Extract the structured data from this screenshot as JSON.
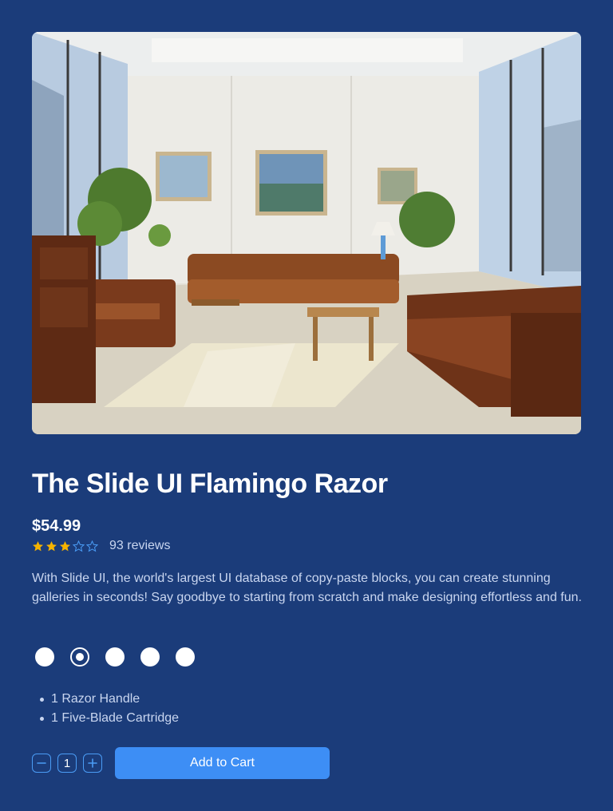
{
  "product": {
    "image_alt": "Sunlit office lounge with brown leather sofas",
    "title": "The Slide UI Flamingo Razor",
    "price": "$54.99",
    "rating": {
      "value": 3,
      "max": 5,
      "reviews_label": "93 reviews"
    },
    "description": "With Slide UI, the world's largest UI database of copy-paste blocks, you can create stunning galleries in seconds! Say goodbye to starting from scratch and make designing effortless and fun.",
    "swatches": {
      "count": 5,
      "selected_index": 1
    },
    "features": [
      "1 Razor Handle",
      "1 Five-Blade Cartridge"
    ],
    "quantity": "1",
    "add_to_cart_label": "Add to Cart"
  },
  "colors": {
    "background": "#1b3c7a",
    "accent": "#3d8ef5",
    "star_filled": "#f5b301",
    "star_empty": "#4a9cf5"
  },
  "icons": [
    "minus-icon",
    "plus-icon",
    "star-icon"
  ]
}
